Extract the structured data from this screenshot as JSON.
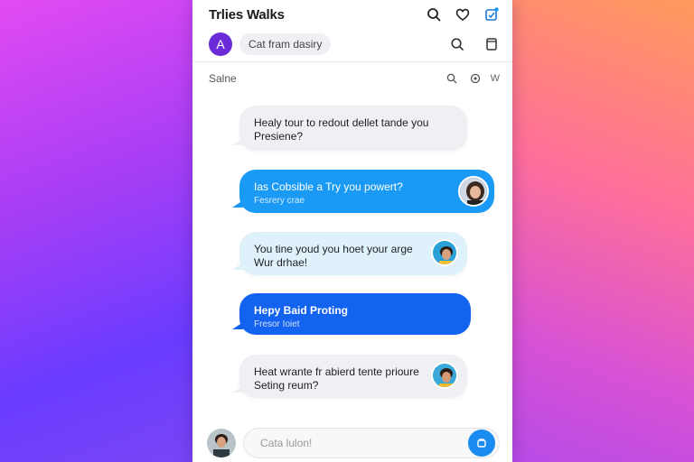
{
  "app": {
    "title": "Trlies Walks",
    "avatar_letter": "A",
    "chip_label": "Cat fram dasiry",
    "section_label": "Salne",
    "section_tag": "W"
  },
  "icons": {
    "header": [
      "search-icon",
      "heart-icon",
      "notification-icon"
    ],
    "subheader": [
      "search-icon",
      "bookmark-icon"
    ],
    "section": [
      "search-icon",
      "settings-icon"
    ]
  },
  "messages": [
    {
      "line1": "Healy tour to redout dellet tande you",
      "line2": "Presiene?",
      "style": "gray"
    },
    {
      "line1": "Ias Cobsible a Try you powert?",
      "line2": "Fesrery crae",
      "style": "blue"
    },
    {
      "line1": "You tine youd you hoet your arge",
      "line2": "Wur drhae!",
      "style": "cyan"
    },
    {
      "line1": "Hepy Baid Proting",
      "line2": "Fresor Ioiet",
      "style": "royal"
    },
    {
      "line1": "Heat wrante fr abierd tente prioure",
      "line2": "Seting reum?",
      "style": "gray"
    }
  ],
  "composer": {
    "placeholder": "Cata lulon!"
  },
  "colors": {
    "accent_blue": "#1a9af5",
    "royal_blue": "#1463f0",
    "avatar_purple": "#6c2bd9"
  }
}
